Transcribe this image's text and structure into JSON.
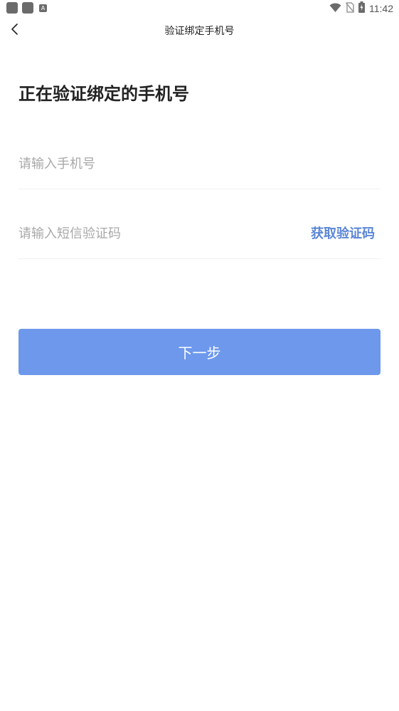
{
  "status_bar": {
    "time": "11:42",
    "left_icons": [
      "app-notification-icon",
      "app-notification-icon",
      "a-notification-icon"
    ],
    "a_label": "A",
    "right_icons": [
      "wifi-icon",
      "no-sim-icon",
      "battery-charging-icon"
    ]
  },
  "header": {
    "title": "验证绑定手机号",
    "back_icon": "chevron-left-icon"
  },
  "main": {
    "heading": "正在验证绑定的手机号",
    "phone_placeholder": "请输入手机号",
    "code_placeholder": "请输入短信验证码",
    "get_code_label": "获取验证码",
    "next_label": "下一步"
  },
  "colors": {
    "accent": "#5b86d6",
    "button": "#6d98ec",
    "placeholder": "#a8a8a8"
  }
}
